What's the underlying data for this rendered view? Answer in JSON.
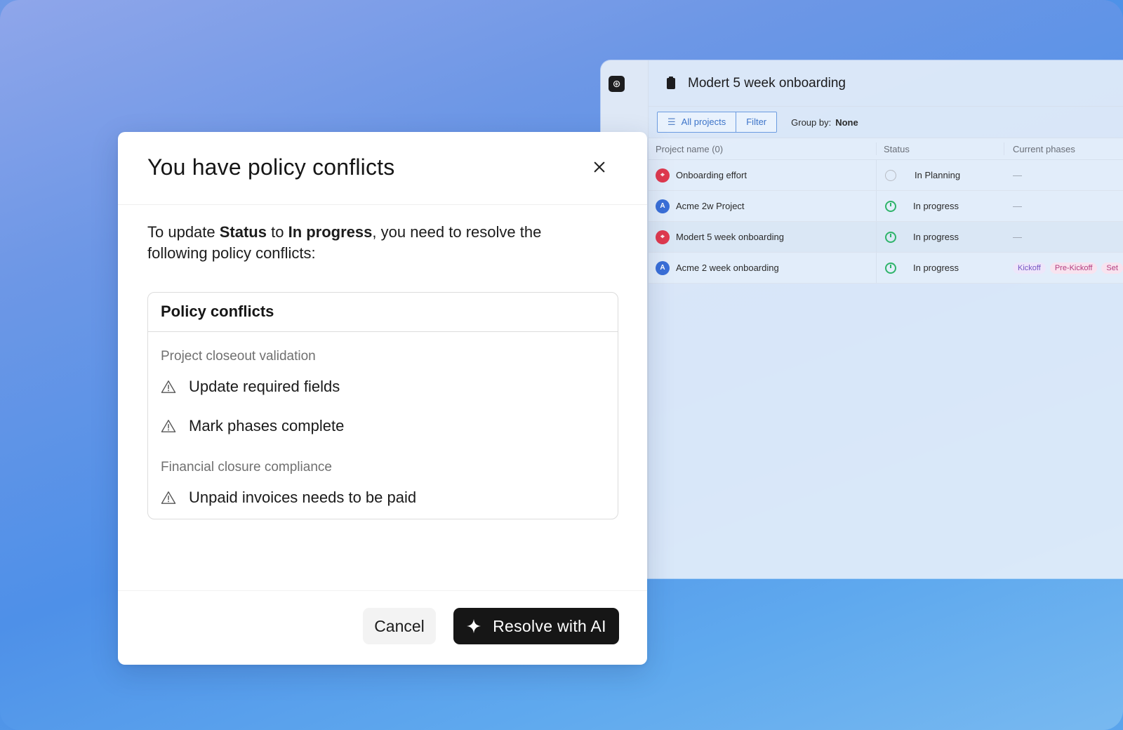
{
  "app": {
    "title": "Modert 5 week onboarding",
    "toolbar": {
      "all_projects": "All projects",
      "filter": "Filter",
      "group_by_label": "Group by:",
      "group_by_value": "None"
    },
    "columns": [
      "Project name (0)",
      "Status",
      "Current phases"
    ],
    "rows": [
      {
        "avatar": "red",
        "initial": "",
        "name": "Onboarding effort",
        "status": "In Planning",
        "status_kind": "planning",
        "phases": "—"
      },
      {
        "avatar": "blue",
        "initial": "A",
        "name": "Acme 2w Project",
        "status": "In progress",
        "status_kind": "progress",
        "phases": "—"
      },
      {
        "avatar": "red",
        "initial": "",
        "name": "Modert 5 week onboarding",
        "status": "In progress",
        "status_kind": "progress",
        "phases": "—"
      },
      {
        "avatar": "blue",
        "initial": "A",
        "name": "Acme 2 week onboarding",
        "status": "In progress",
        "status_kind": "progress",
        "phases_tags": [
          "Kickoff",
          "Pre-Kickoff",
          "Set"
        ]
      }
    ]
  },
  "modal": {
    "title": "You have policy conflicts",
    "desc_prefix": "To update ",
    "desc_field": "Status",
    "desc_mid": " to ",
    "desc_value": "In progress",
    "desc_suffix": ", you need to resolve the following policy conflicts:",
    "box_title": "Policy conflicts",
    "groups": [
      {
        "name": "Project closeout validation",
        "items": [
          "Update required fields",
          "Mark phases complete"
        ]
      },
      {
        "name": "Financial closure compliance",
        "items": [
          "Unpaid invoices needs to be paid"
        ]
      }
    ],
    "cancel_label": "Cancel",
    "resolve_label": "Resolve with AI"
  },
  "colors": {
    "accent_dark": "#161616",
    "status_green": "#2fb46a",
    "avatar_red": "#e0394e",
    "avatar_blue": "#3a6fd8"
  }
}
